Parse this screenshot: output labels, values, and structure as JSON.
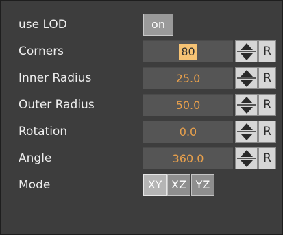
{
  "panel": {
    "use_lod": {
      "label": "use LOD",
      "button": "on"
    },
    "corners": {
      "label": "Corners",
      "value": "80",
      "reset": "R"
    },
    "inner_radius": {
      "label": "Inner Radius",
      "value": "25.0",
      "reset": "R"
    },
    "outer_radius": {
      "label": "Outer Radius",
      "value": "50.0",
      "reset": "R"
    },
    "rotation": {
      "label": "Rotation",
      "value": "0.0",
      "reset": "R"
    },
    "angle": {
      "label": "Angle",
      "value": "360.0",
      "reset": "R"
    },
    "mode": {
      "label": "Mode",
      "options": [
        "XY",
        "XZ",
        "YZ"
      ],
      "selected": "XY"
    }
  },
  "colors": {
    "panel_bg": "#3d3d3d",
    "field_bg": "#555555",
    "value_text": "#e8a04c",
    "highlight": "#f6c374"
  }
}
